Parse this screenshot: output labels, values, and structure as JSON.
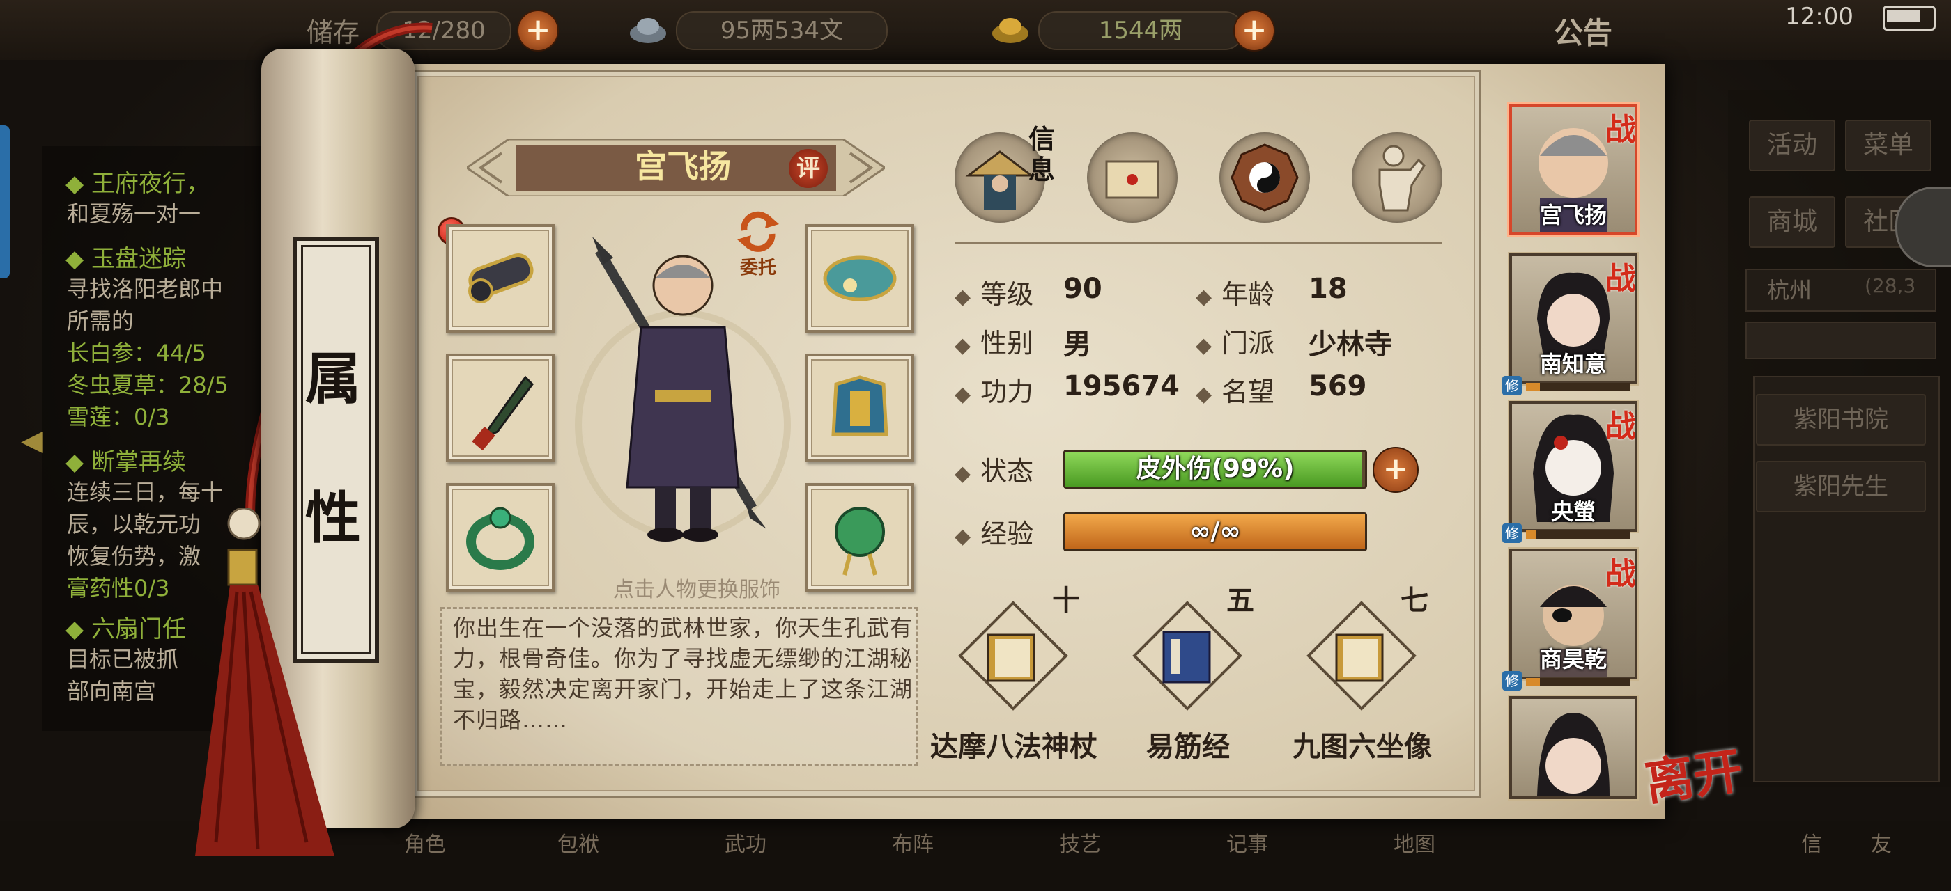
{
  "status_bar": {
    "time": "12:00"
  },
  "top_bar": {
    "bag_label": "储存",
    "bag_count": "12/280",
    "silver": "95两534文",
    "gold": "1544两",
    "notice": "公告"
  },
  "quests": [
    {
      "title": "王府夜行，",
      "lines": [
        "和夏殇一对一"
      ]
    },
    {
      "title": "玉盘迷踪",
      "lines": [
        "寻找洛阳老郎中",
        "所需的"
      ],
      "items": [
        "长白参：44/5",
        "冬虫夏草：28/5",
        "雪莲：0/3"
      ]
    },
    {
      "title": "断掌再续",
      "lines": [
        "连续三日，每十",
        "辰，以乾元功",
        "恢复伤势，激"
      ],
      "items": [
        "膏药性0/3"
      ]
    },
    {
      "title": "六扇门任",
      "lines": [
        "目标已被抓",
        "部向南宫"
      ]
    }
  ],
  "right_menu": {
    "activity": "活动",
    "menu": "菜单",
    "shop": "商城",
    "society": "社区",
    "location": "杭州",
    "coords": "(28,3",
    "npc1": "紫阳书院",
    "npc2": "紫阳先生"
  },
  "bottom_nav": [
    "角色",
    "包袱",
    "武功",
    "布阵",
    "技艺",
    "记事",
    "地图",
    "信",
    "友"
  ],
  "scroll_label": [
    "属",
    "性"
  ],
  "character": {
    "name": "宫飞扬",
    "eval_label": "评",
    "entrust_label": "委托",
    "hint": "点击人物更换服饰",
    "bio": "你出生在一个没落的武林世家，你天生孔武有力，根骨奇佳。你为了寻找虚无缥缈的江湖秘宝，毅然决定离开家门，开始走上了这条江湖不归路……"
  },
  "tabs": {
    "info_label": "信息",
    "icons": [
      "info-tab",
      "scroll-tab",
      "bagua-tab",
      "meridian-tab"
    ]
  },
  "stats": {
    "level_k": "等级",
    "level_v": "90",
    "age_k": "年龄",
    "age_v": "18",
    "gender_k": "性别",
    "gender_v": "男",
    "sect_k": "门派",
    "sect_v": "少林寺",
    "power_k": "功力",
    "power_v": "195674",
    "fame_k": "名望",
    "fame_v": "569",
    "state_k": "状态",
    "state_v": "皮外伤(99%)",
    "state_ratio": 0.99,
    "exp_k": "经验",
    "exp_v": "∞/∞",
    "exp_ratio": 1.0
  },
  "skills": [
    {
      "level": "十",
      "name": "达摩八法神杖"
    },
    {
      "level": "五",
      "name": "易筋经"
    },
    {
      "level": "七",
      "name": "九图六坐像"
    }
  ],
  "party": [
    {
      "name": "宫飞扬",
      "war": "战",
      "selected": true
    },
    {
      "name": "南知意",
      "war": "战",
      "xiu": "修"
    },
    {
      "name": "央螢",
      "war": "战",
      "xiu": "修"
    },
    {
      "name": "商昊乾",
      "war": "战",
      "xiu": "修"
    },
    {
      "name": "",
      "war": ""
    }
  ],
  "leave": "离开",
  "colors": {
    "state_bar": "#6fbf3a",
    "exp_bar": "#e08a2a",
    "war_red": "#d42b1a",
    "banner": "#7a5a44"
  }
}
